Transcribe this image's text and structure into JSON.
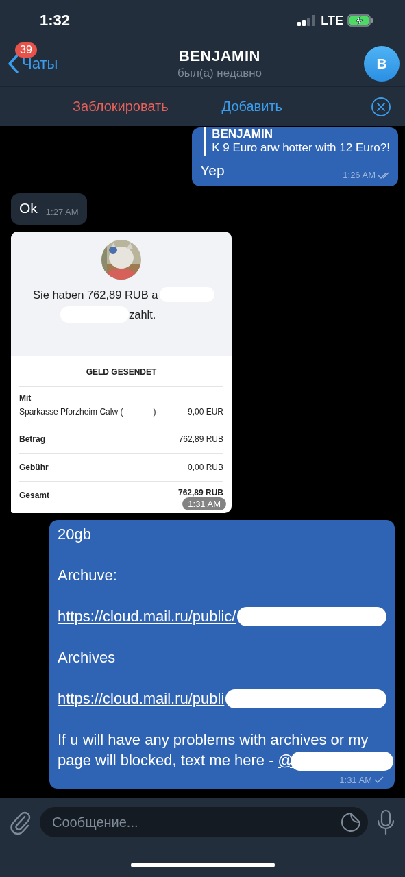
{
  "status_bar": {
    "time": "1:32",
    "network": "LTE"
  },
  "header": {
    "back_label": "Чаты",
    "unread_badge": "39",
    "title": "BENJAMIN",
    "subtitle": "был(а) недавно",
    "avatar_letter": "B"
  },
  "action_bar": {
    "block_label": "Заблокировать",
    "add_label": "Добавить"
  },
  "messages": [
    {
      "kind": "text",
      "outgoing": true,
      "reply": {
        "name": "BENJAMIN",
        "text": "K 9 Euro arw hotter with 12 Euro?!"
      },
      "paragraphs": [
        {
          "kind": "text",
          "text": "Yep"
        }
      ],
      "time": "1:26 AM",
      "read": true
    },
    {
      "kind": "text",
      "outgoing": false,
      "paragraphs": [
        {
          "kind": "text",
          "text": "Ok"
        }
      ],
      "time": "1:27 AM"
    },
    {
      "kind": "receipt",
      "outgoing": false,
      "time": "1:31 AM",
      "receipt": {
        "headline_start": "Sie haben 762,89 RUB a",
        "headline_end": "zahlt.",
        "section_title": "GELD GESENDET",
        "rows": [
          {
            "label": "Mit",
            "detail": "Sparkasse Pforzheim Calw (",
            "detail_end": ")",
            "value": "9,00 EUR"
          },
          {
            "label": "Betrag",
            "value": "762,89 RUB"
          },
          {
            "label": "Gebühr",
            "value": "0,00 RUB"
          },
          {
            "label": "Gesamt",
            "value": "762,89 RUB"
          }
        ]
      }
    },
    {
      "kind": "text",
      "outgoing": true,
      "paragraphs": [
        {
          "kind": "text",
          "text": "20gb"
        },
        {
          "kind": "text",
          "text": "Archuve:"
        },
        {
          "kind": "link",
          "text": "https://cloud.mail.ru/public/",
          "redacted": true
        },
        {
          "kind": "text",
          "text": "Archives"
        },
        {
          "kind": "link",
          "text": "https://cloud.mail.ru/publi",
          "redacted": true
        },
        {
          "kind": "mixed",
          "text": "If u will have any problems with archives or my page will blocked, text me here - ",
          "link": "@",
          "redacted": true
        }
      ],
      "time": "1:31 AM",
      "read": false
    }
  ],
  "composer": {
    "placeholder": "Сообщение..."
  }
}
